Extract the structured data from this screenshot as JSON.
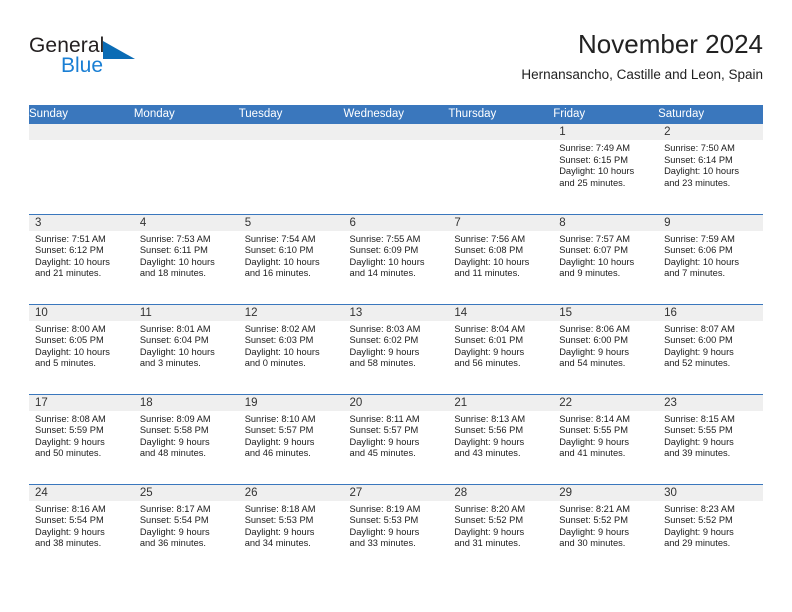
{
  "brand": {
    "name_top": "General",
    "name_bottom": "Blue",
    "logo_icon": "triangle-icon",
    "color_dark": "#231f20",
    "color_blue": "#1a7fd4",
    "triangle_color": "#0b6cb5"
  },
  "header": {
    "title": "November 2024",
    "subtitle": "Hernansancho, Castille and Leon, Spain"
  },
  "theme": {
    "header_blue": "#3a77bd",
    "daynum_band": "#efefef",
    "text": "#1c1c1c"
  },
  "weekdays": [
    "Sunday",
    "Monday",
    "Tuesday",
    "Wednesday",
    "Thursday",
    "Friday",
    "Saturday"
  ],
  "weeks": [
    [
      {
        "day": "",
        "blank": true
      },
      {
        "day": "",
        "blank": true
      },
      {
        "day": "",
        "blank": true
      },
      {
        "day": "",
        "blank": true
      },
      {
        "day": "",
        "blank": true
      },
      {
        "day": "1",
        "sunrise": "Sunrise: 7:49 AM",
        "sunset": "Sunset: 6:15 PM",
        "daylight1": "Daylight: 10 hours",
        "daylight2": "and 25 minutes."
      },
      {
        "day": "2",
        "sunrise": "Sunrise: 7:50 AM",
        "sunset": "Sunset: 6:14 PM",
        "daylight1": "Daylight: 10 hours",
        "daylight2": "and 23 minutes."
      }
    ],
    [
      {
        "day": "3",
        "sunrise": "Sunrise: 7:51 AM",
        "sunset": "Sunset: 6:12 PM",
        "daylight1": "Daylight: 10 hours",
        "daylight2": "and 21 minutes."
      },
      {
        "day": "4",
        "sunrise": "Sunrise: 7:53 AM",
        "sunset": "Sunset: 6:11 PM",
        "daylight1": "Daylight: 10 hours",
        "daylight2": "and 18 minutes."
      },
      {
        "day": "5",
        "sunrise": "Sunrise: 7:54 AM",
        "sunset": "Sunset: 6:10 PM",
        "daylight1": "Daylight: 10 hours",
        "daylight2": "and 16 minutes."
      },
      {
        "day": "6",
        "sunrise": "Sunrise: 7:55 AM",
        "sunset": "Sunset: 6:09 PM",
        "daylight1": "Daylight: 10 hours",
        "daylight2": "and 14 minutes."
      },
      {
        "day": "7",
        "sunrise": "Sunrise: 7:56 AM",
        "sunset": "Sunset: 6:08 PM",
        "daylight1": "Daylight: 10 hours",
        "daylight2": "and 11 minutes."
      },
      {
        "day": "8",
        "sunrise": "Sunrise: 7:57 AM",
        "sunset": "Sunset: 6:07 PM",
        "daylight1": "Daylight: 10 hours",
        "daylight2": "and 9 minutes."
      },
      {
        "day": "9",
        "sunrise": "Sunrise: 7:59 AM",
        "sunset": "Sunset: 6:06 PM",
        "daylight1": "Daylight: 10 hours",
        "daylight2": "and 7 minutes."
      }
    ],
    [
      {
        "day": "10",
        "sunrise": "Sunrise: 8:00 AM",
        "sunset": "Sunset: 6:05 PM",
        "daylight1": "Daylight: 10 hours",
        "daylight2": "and 5 minutes."
      },
      {
        "day": "11",
        "sunrise": "Sunrise: 8:01 AM",
        "sunset": "Sunset: 6:04 PM",
        "daylight1": "Daylight: 10 hours",
        "daylight2": "and 3 minutes."
      },
      {
        "day": "12",
        "sunrise": "Sunrise: 8:02 AM",
        "sunset": "Sunset: 6:03 PM",
        "daylight1": "Daylight: 10 hours",
        "daylight2": "and 0 minutes."
      },
      {
        "day": "13",
        "sunrise": "Sunrise: 8:03 AM",
        "sunset": "Sunset: 6:02 PM",
        "daylight1": "Daylight: 9 hours",
        "daylight2": "and 58 minutes."
      },
      {
        "day": "14",
        "sunrise": "Sunrise: 8:04 AM",
        "sunset": "Sunset: 6:01 PM",
        "daylight1": "Daylight: 9 hours",
        "daylight2": "and 56 minutes."
      },
      {
        "day": "15",
        "sunrise": "Sunrise: 8:06 AM",
        "sunset": "Sunset: 6:00 PM",
        "daylight1": "Daylight: 9 hours",
        "daylight2": "and 54 minutes."
      },
      {
        "day": "16",
        "sunrise": "Sunrise: 8:07 AM",
        "sunset": "Sunset: 6:00 PM",
        "daylight1": "Daylight: 9 hours",
        "daylight2": "and 52 minutes."
      }
    ],
    [
      {
        "day": "17",
        "sunrise": "Sunrise: 8:08 AM",
        "sunset": "Sunset: 5:59 PM",
        "daylight1": "Daylight: 9 hours",
        "daylight2": "and 50 minutes."
      },
      {
        "day": "18",
        "sunrise": "Sunrise: 8:09 AM",
        "sunset": "Sunset: 5:58 PM",
        "daylight1": "Daylight: 9 hours",
        "daylight2": "and 48 minutes."
      },
      {
        "day": "19",
        "sunrise": "Sunrise: 8:10 AM",
        "sunset": "Sunset: 5:57 PM",
        "daylight1": "Daylight: 9 hours",
        "daylight2": "and 46 minutes."
      },
      {
        "day": "20",
        "sunrise": "Sunrise: 8:11 AM",
        "sunset": "Sunset: 5:57 PM",
        "daylight1": "Daylight: 9 hours",
        "daylight2": "and 45 minutes."
      },
      {
        "day": "21",
        "sunrise": "Sunrise: 8:13 AM",
        "sunset": "Sunset: 5:56 PM",
        "daylight1": "Daylight: 9 hours",
        "daylight2": "and 43 minutes."
      },
      {
        "day": "22",
        "sunrise": "Sunrise: 8:14 AM",
        "sunset": "Sunset: 5:55 PM",
        "daylight1": "Daylight: 9 hours",
        "daylight2": "and 41 minutes."
      },
      {
        "day": "23",
        "sunrise": "Sunrise: 8:15 AM",
        "sunset": "Sunset: 5:55 PM",
        "daylight1": "Daylight: 9 hours",
        "daylight2": "and 39 minutes."
      }
    ],
    [
      {
        "day": "24",
        "sunrise": "Sunrise: 8:16 AM",
        "sunset": "Sunset: 5:54 PM",
        "daylight1": "Daylight: 9 hours",
        "daylight2": "and 38 minutes."
      },
      {
        "day": "25",
        "sunrise": "Sunrise: 8:17 AM",
        "sunset": "Sunset: 5:54 PM",
        "daylight1": "Daylight: 9 hours",
        "daylight2": "and 36 minutes."
      },
      {
        "day": "26",
        "sunrise": "Sunrise: 8:18 AM",
        "sunset": "Sunset: 5:53 PM",
        "daylight1": "Daylight: 9 hours",
        "daylight2": "and 34 minutes."
      },
      {
        "day": "27",
        "sunrise": "Sunrise: 8:19 AM",
        "sunset": "Sunset: 5:53 PM",
        "daylight1": "Daylight: 9 hours",
        "daylight2": "and 33 minutes."
      },
      {
        "day": "28",
        "sunrise": "Sunrise: 8:20 AM",
        "sunset": "Sunset: 5:52 PM",
        "daylight1": "Daylight: 9 hours",
        "daylight2": "and 31 minutes."
      },
      {
        "day": "29",
        "sunrise": "Sunrise: 8:21 AM",
        "sunset": "Sunset: 5:52 PM",
        "daylight1": "Daylight: 9 hours",
        "daylight2": "and 30 minutes."
      },
      {
        "day": "30",
        "sunrise": "Sunrise: 8:23 AM",
        "sunset": "Sunset: 5:52 PM",
        "daylight1": "Daylight: 9 hours",
        "daylight2": "and 29 minutes."
      }
    ]
  ]
}
